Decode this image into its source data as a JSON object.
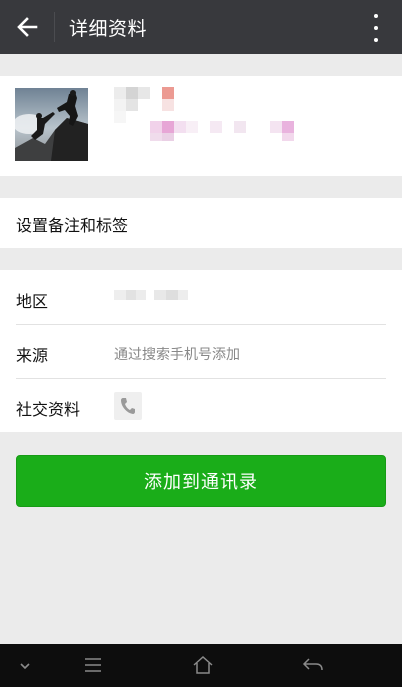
{
  "header": {
    "title": "详细资料",
    "back_icon": "arrow-left-icon",
    "more_icon": "more-vertical-icon"
  },
  "profile": {
    "avatar_icon": "avatar-photo-climbers"
  },
  "remark": {
    "label": "设置备注和标签"
  },
  "info": {
    "region_label": "地区",
    "source_label": "来源",
    "source_value": "通过搜索手机号添加",
    "social_label": "社交资料",
    "social_icon": "phone-icon"
  },
  "actions": {
    "add_label": "添加到通讯录"
  },
  "colors": {
    "topbar": "#38393d",
    "accent_green": "#1aad19",
    "background": "#ebebeb"
  },
  "system_nav": {
    "icons": [
      "chevron-down-icon",
      "menu-icon",
      "home-icon",
      "back-icon"
    ]
  }
}
